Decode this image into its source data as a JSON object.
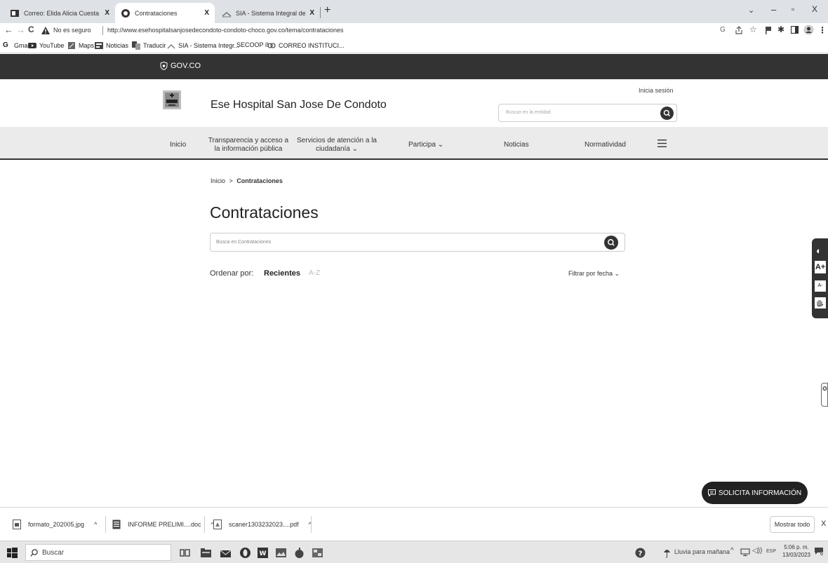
{
  "browser": {
    "tabs": [
      {
        "title": "Correo: Elida Alicia Cuesta Garcia",
        "close": "X",
        "favicon": "outlook-icon"
      },
      {
        "title": "Contrataciones",
        "close": "X",
        "favicon": "globe-icon"
      },
      {
        "title": "SIA - Sistema Integral de Auditor",
        "close": "X",
        "favicon": "sia-icon"
      }
    ],
    "new_tab": "+",
    "url_warning": "No es seguro",
    "url": "http://www.esehospitalsanjosedecondoto-condoto-choco.gov.co/tema/contrataciones",
    "bookmarks": [
      {
        "label": "Gmail",
        "icon": "g-icon"
      },
      {
        "label": "YouTube",
        "icon": "youtube-icon"
      },
      {
        "label": "Maps",
        "icon": "maps-icon"
      },
      {
        "label": "Noticias",
        "icon": "news-icon"
      },
      {
        "label": "Traducir",
        "icon": "translate-icon"
      },
      {
        "label": "SIA - Sistema Integr...",
        "icon": "sia-icon"
      },
      {
        "label": "SECOOP II",
        "icon": "none"
      },
      {
        "label": "CORREO INSTITUCI...",
        "icon": "link-icon"
      }
    ]
  },
  "gov": {
    "label": "GOV.CO"
  },
  "site": {
    "name": "Ese Hospital San Jose De Condoto",
    "login": "Inicia sesión",
    "search_placeholder": "Buscar en la entidad",
    "nav": {
      "home": "Inicio",
      "transparency_line1": "Transparencia y acceso a",
      "transparency_line2": "la información pública",
      "services_line1": "Servicios de atención a la",
      "services_line2": "ciudadanía",
      "participa": "Participa",
      "noticias": "Noticias",
      "normatividad": "Normatividad"
    }
  },
  "content": {
    "breadcrumb_home": "Inicio",
    "breadcrumb_sep": ">",
    "breadcrumb_current": "Contrataciones",
    "title": "Contrataciones",
    "search_placeholder": "Busca en Contrataciones",
    "sort_label": "Ordenar por:",
    "sort_recent": "Recientes",
    "sort_az": "A-Z",
    "filter_date": "Filtrar por fecha"
  },
  "accessibility": {
    "contrast": "◐",
    "font_up": "A+",
    "font_down": "A-"
  },
  "cta": {
    "label": "SOLICITA INFORMACIÓN"
  },
  "downloads": {
    "items": [
      {
        "name": "formato_202005.jpg"
      },
      {
        "name": "INFORME PRELIMI....doc"
      },
      {
        "name": "scaner1303232023....pdf"
      }
    ],
    "show_all": "Mostrar todo",
    "close": "X"
  },
  "taskbar": {
    "search": "Buscar",
    "weather": "Lluvia para mañana",
    "lang": "ESP",
    "time": "5:06 p. m.",
    "date": "13/03/2023",
    "notification_count": "6"
  }
}
